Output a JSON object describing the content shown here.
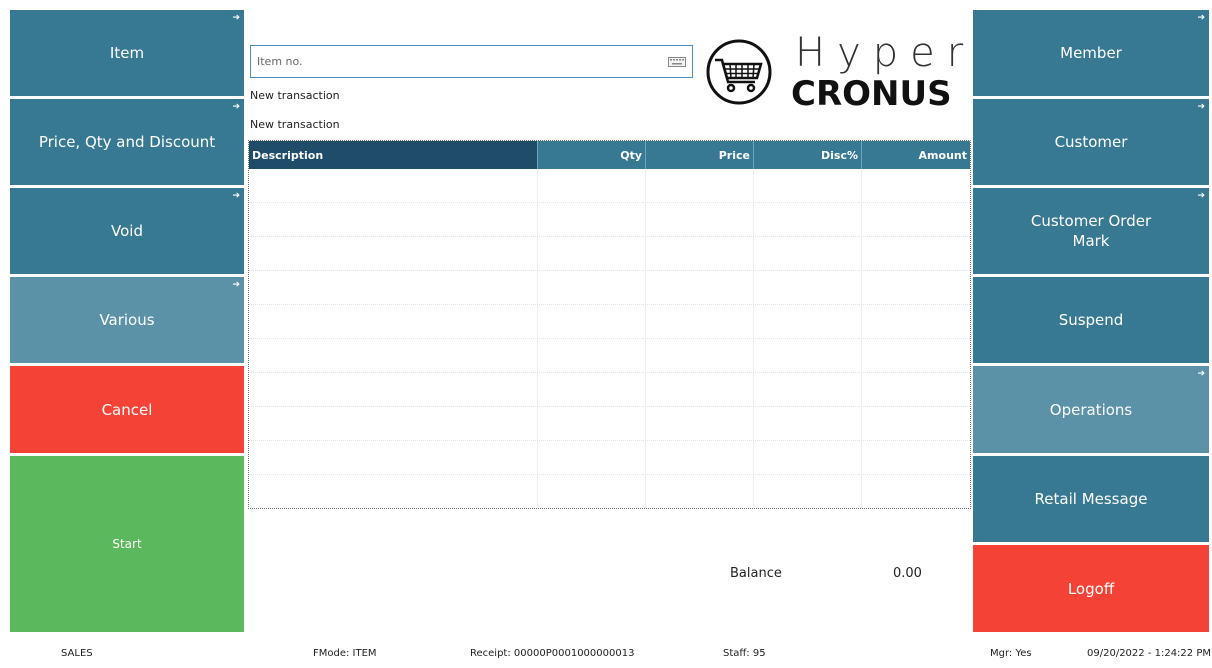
{
  "left_buttons": {
    "item": "Item",
    "price_qty_discount": "Price, Qty and Discount",
    "void": "Void",
    "various": "Various",
    "cancel": "Cancel",
    "start": "Start"
  },
  "right_buttons": {
    "member": "Member",
    "customer": "Customer",
    "customer_order_mark": "Customer Order Mark",
    "suspend": "Suspend",
    "operations": "Operations",
    "retail_message": "Retail Message",
    "logoff": "Logoff"
  },
  "search": {
    "placeholder": "Item no.",
    "value": ""
  },
  "info_lines": [
    "New transaction",
    "New transaction"
  ],
  "logo": {
    "line1": "Hyper",
    "line2": "CRONUS"
  },
  "grid": {
    "columns": [
      "Description",
      "Qty",
      "Price",
      "Disc%",
      "Amount"
    ],
    "rows": []
  },
  "balance": {
    "label": "Balance",
    "value": "0.00"
  },
  "status": {
    "mode": "SALES",
    "fmode": "FMode: ITEM",
    "receipt": "Receipt: 00000P0001000000013",
    "staff": "Staff: 95",
    "mgr": "Mgr: Yes",
    "datetime": "09/20/2022 - 1:24:22 PM"
  },
  "colors": {
    "dark_button": "#377892",
    "light_button": "#5c92a8",
    "cancel_red": "#f44336",
    "start_green": "#5cb85c",
    "grid_header_dark": "#1f4d69"
  },
  "icons": [
    "arrow-right-icon",
    "keyboard-icon",
    "shopping-cart-icon"
  ]
}
